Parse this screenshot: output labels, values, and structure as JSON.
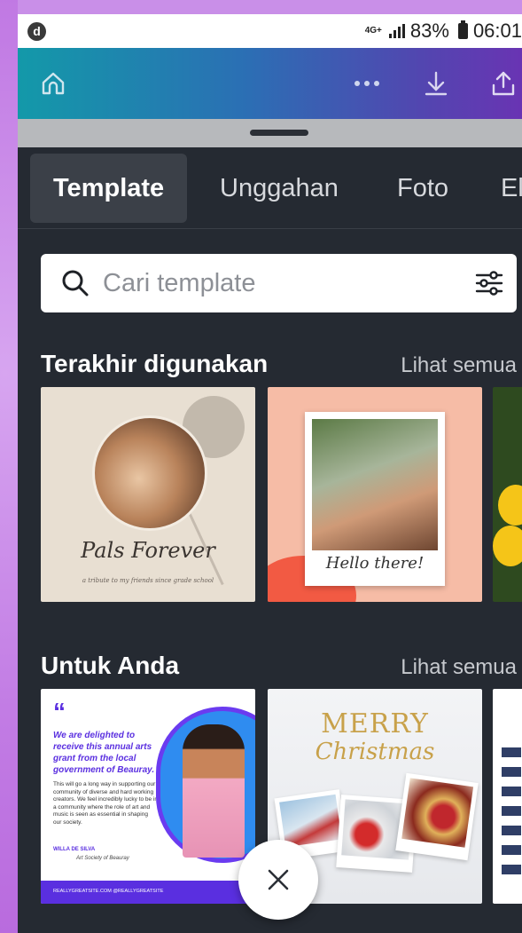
{
  "status_bar": {
    "app_icon_letter": "d",
    "network": "4G+",
    "battery": "83%",
    "time": "06:01"
  },
  "toolbar": {
    "icons": [
      "home-icon",
      "more-icon",
      "download-icon",
      "share-icon"
    ]
  },
  "tabs": [
    {
      "label": "Template",
      "active": true
    },
    {
      "label": "Unggahan",
      "active": false
    },
    {
      "label": "Foto",
      "active": false
    },
    {
      "label": "Elemen",
      "active": false
    }
  ],
  "search": {
    "placeholder": "Cari template",
    "value": ""
  },
  "sections": {
    "recent": {
      "title": "Terakhir digunakan",
      "see_all": "Lihat semua",
      "cards": [
        {
          "script": "Pals Forever",
          "caption": "a tribute to my friends since grade school"
        },
        {
          "script": "Hello there!"
        },
        {}
      ]
    },
    "for_you": {
      "title": "Untuk Anda",
      "see_all": "Lihat semua",
      "cards": [
        {
          "quote_mark": "“",
          "headline": "We are delighted to receive this annual arts grant from the local government of Beauray.",
          "body": "This will go a long way in supporting our community of diverse and hard working creators. We feel incredibly lucky to be in a community where the role of art and music is seen as essential in shaping our society.",
          "author": "WILLA DE SILVA",
          "author_role": "Art Society of Beauray",
          "footer": "REALLYGREATSITE.COM   @REALLYGREATSITE"
        },
        {
          "merry": "MERRY",
          "christmas": "Christmas"
        },
        {}
      ]
    }
  },
  "close_button": {
    "icon": "close-icon"
  },
  "colors": {
    "toolbar_start": "#1399a9",
    "toolbar_end": "#6934b3",
    "panel_bg": "#252a32",
    "accent_purple": "#5a2fe0"
  }
}
